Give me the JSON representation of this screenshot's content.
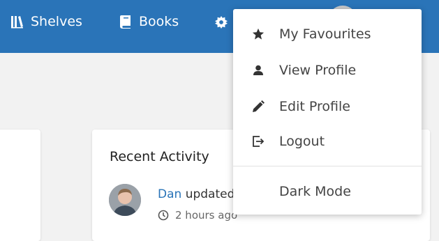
{
  "header": {
    "nav": {
      "shelves_label": "Shelves",
      "books_label": "Books"
    },
    "settings_icon": "gear-icon",
    "colors": {
      "bar": "#2a74b8",
      "text": "#ffffff"
    }
  },
  "dropdown": {
    "items": [
      {
        "label": "My Favourites",
        "icon": "star-icon"
      },
      {
        "label": "View Profile",
        "icon": "person-icon"
      },
      {
        "label": "Edit Profile",
        "icon": "pencil-icon"
      },
      {
        "label": "Logout",
        "icon": "logout-icon"
      },
      {
        "label": "Dark Mode",
        "icon": "moon-icon"
      }
    ]
  },
  "recent_activity": {
    "title": "Recent Activity",
    "entries": [
      {
        "user": "Dan",
        "action": "updated",
        "time": "2 hours ago"
      }
    ],
    "link_color": "#2a74b8"
  }
}
